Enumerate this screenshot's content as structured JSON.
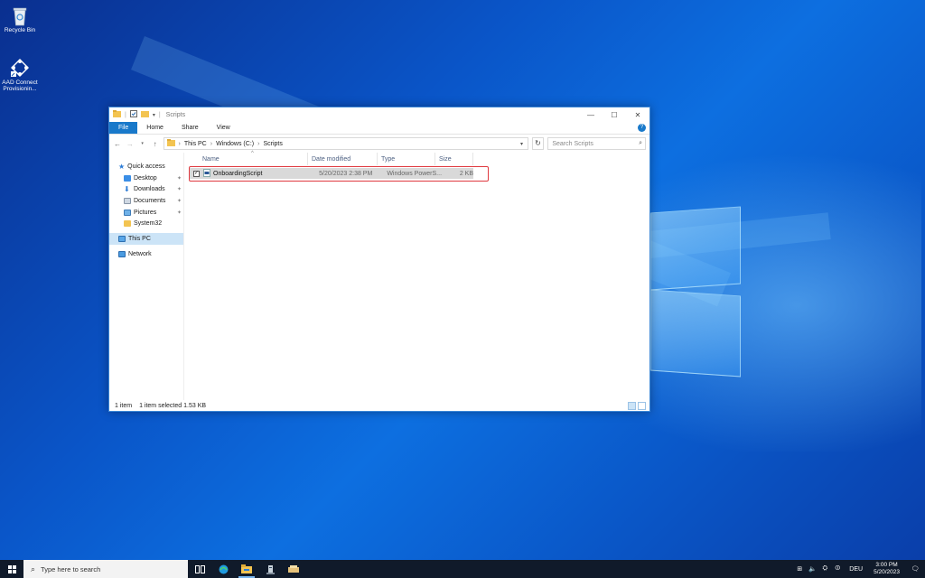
{
  "desktop": {
    "icons": [
      {
        "label": "Recycle Bin",
        "icon": "recycle-bin-icon"
      },
      {
        "label": "AAD Connect Provisionin...",
        "icon": "aad-connect-icon"
      }
    ]
  },
  "window": {
    "title": "Scripts",
    "controls": {
      "minimize": "—",
      "maximize": "☐",
      "close": "✕"
    },
    "ribbon_tabs": [
      "File",
      "Home",
      "Share",
      "View"
    ],
    "help": "?",
    "address": {
      "crumbs": [
        "This PC",
        "Windows (C:)",
        "Scripts"
      ],
      "separator": "›"
    },
    "search_placeholder": "Search Scripts",
    "nav": {
      "quick_access": "Quick access",
      "items": [
        "Desktop",
        "Downloads",
        "Documents",
        "Pictures",
        "System32"
      ],
      "this_pc": "This PC",
      "network": "Network"
    },
    "columns": [
      "Name",
      "Date modified",
      "Type",
      "Size"
    ],
    "files": [
      {
        "name": "OnboardingScript",
        "date": "5/20/2023 2:38 PM",
        "type": "Windows PowerS...",
        "size": "2 KB",
        "checked": true
      }
    ],
    "status": {
      "count": "1 item",
      "selected": "1 item selected",
      "size": "1.53 KB"
    }
  },
  "taskbar": {
    "search_placeholder": "Type here to search",
    "language": "DEU",
    "time": "3:00 PM",
    "date": "5/20/2023"
  },
  "colors": {
    "accent": "#1979ca",
    "highlight_border": "#e0393f",
    "selected_row": "#d9d9d9",
    "taskbar": "#101a2a"
  }
}
